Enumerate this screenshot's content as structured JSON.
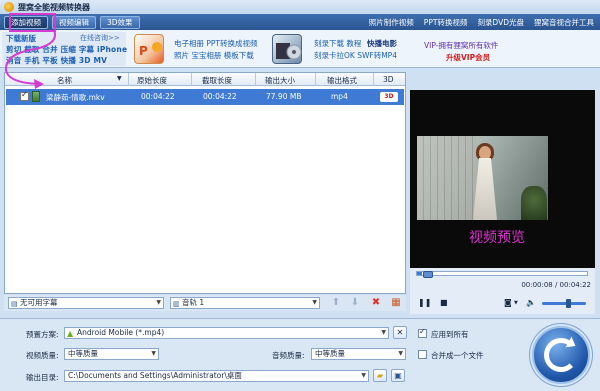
{
  "window": {
    "title": "狸窝全能视频转换器"
  },
  "toolbar": {
    "add_video": "添加视频",
    "edit_video": "视频编辑",
    "effect_3d": "3D效果",
    "links": [
      "照片制作视频",
      "PPT转换视频",
      "刻录DVD光盘",
      "狸窝音视合并工具"
    ]
  },
  "ads": {
    "download_title": "下载新版",
    "online_help": "在线咨询>>",
    "download_row1": "剪切 截取 合并 压缩 字幕 iPhone",
    "download_row2": "消音 手机 平板 快播 3D MV",
    "ppt_line1": "电子相册 PPT转换成视频",
    "ppt_line2": "照片 宝宝相册 模板下载",
    "burn_line1": "刻录下载 教程",
    "burn_highlight": "快播电影",
    "burn_line2": "刻录卡拉OK SWF转MP4",
    "vip_line1": "VIP-拥有狸窝所有软件",
    "vip_line2": "升级VIP会员"
  },
  "file_list": {
    "columns": [
      "名称",
      "原始长度",
      "截取长度",
      "输出大小",
      "输出格式",
      "3D"
    ],
    "rows": [
      {
        "name": "梁静茹-情歌.mkv",
        "original_length": "00:04:22",
        "clip_length": "00:04:22",
        "output_size": "77.90 MB",
        "output_format": "mp4",
        "badge_3d": "3D"
      }
    ]
  },
  "tracks": {
    "subtitle": "无可用字幕",
    "audio": "音轨 1"
  },
  "preview": {
    "label": "视频预览",
    "timecode": "00:00:08 / 00:04:22",
    "progress": 0.03,
    "volume": 0.6
  },
  "settings": {
    "preset_label": "预置方案:",
    "preset_value": "Android Mobile (*.mp4)",
    "video_quality_label": "视频质量:",
    "video_quality_value": "中等质量",
    "audio_quality_label": "音频质量:",
    "audio_quality_value": "中等质量",
    "output_dir_label": "输出目录:",
    "output_dir_value": "C:\\Documents and Settings\\Administrator\\桌面",
    "apply_all": "应用到所有",
    "merge_one": "合并成一个文件",
    "apply_all_checked": true,
    "merge_one_checked": false
  },
  "colors": {
    "accent": "#3f7bd4",
    "annotation": "#d63ad1",
    "vip_red": "#d02020"
  }
}
